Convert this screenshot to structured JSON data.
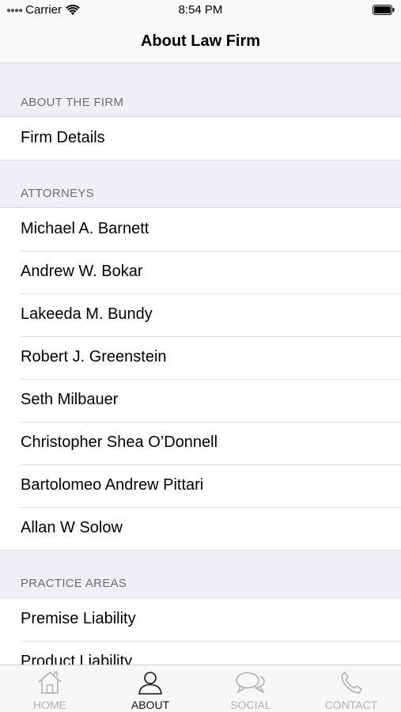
{
  "status_bar": {
    "carrier": "Carrier",
    "time": "8:54 PM",
    "signal_icon": "signal-dots-icon",
    "wifi_icon": "wifi-icon",
    "battery_icon": "battery-icon"
  },
  "nav": {
    "title": "About Law Firm"
  },
  "sections": {
    "firm": {
      "header": "ABOUT THE FIRM",
      "items": [
        "Firm Details"
      ]
    },
    "attorneys": {
      "header": "ATTORNEYS",
      "items": [
        "Michael A. Barnett",
        "Andrew W. Bokar",
        "Lakeeda M. Bundy",
        "Robert J. Greenstein",
        "Seth Milbauer",
        "Christopher Shea O’Donnell",
        "Bartolomeo Andrew Pittari",
        "Allan W Solow"
      ]
    },
    "practice": {
      "header": "PRACTICE AREAS",
      "items": [
        "Premise Liability",
        "Product Liability"
      ]
    }
  },
  "tabs": [
    {
      "label": "HOME",
      "icon": "home-icon",
      "active": false
    },
    {
      "label": "ABOUT",
      "icon": "person-icon",
      "active": true
    },
    {
      "label": "SOCIAL",
      "icon": "chat-bubbles-icon",
      "active": false
    },
    {
      "label": "CONTACT",
      "icon": "phone-icon",
      "active": false
    }
  ],
  "colors": {
    "background": "#efeff4",
    "section_header_text": "#6d6d72",
    "tab_inactive": "#b0b0b4",
    "tab_active": "#111111"
  }
}
